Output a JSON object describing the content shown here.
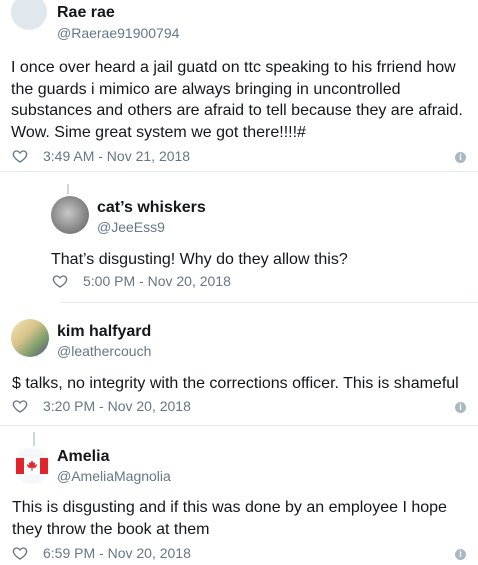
{
  "tweets": [
    {
      "name": "Rae rae",
      "handle": "@Raerae91900794",
      "text": "I once over heard a jail guatd on ttc speaking to his frriend how the guards i mimico are always bringing in uncontrolled substances and others are afraid to tell because they are afraid. Wow. Sime great system we got there!!!!#",
      "time": "3:49 AM - Nov 21, 2018"
    },
    {
      "name": "cat’s whiskers",
      "handle": "@JeeEss9",
      "text": "That’s disgusting! Why do they allow this?",
      "time": "5:00 PM - Nov 20, 2018"
    },
    {
      "name": "kim halfyard",
      "handle": "@leathercouch",
      "text": "$ talks, no integrity with the corrections officer. This is shameful",
      "time": "3:20 PM - Nov 20, 2018"
    },
    {
      "name": "Amelia",
      "handle": "@AmeliaMagnolia",
      "text": "This is disgusting and if this was done by an employee I hope they throw the book at them",
      "time": "6:59 PM - Nov 20, 2018"
    }
  ],
  "icons": {
    "like": "heart-outline-icon",
    "info": "info-icon"
  },
  "colors": {
    "text": "#14171a",
    "secondary": "#657786",
    "divider": "#e6ecf0",
    "info": "#aab8c2"
  }
}
